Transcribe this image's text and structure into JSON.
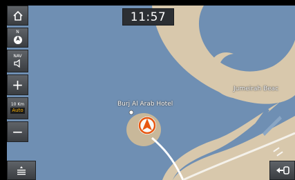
{
  "status": {
    "time": "11:57"
  },
  "controls": {
    "home_icon": "home-icon",
    "compass_label": "N",
    "nav_label": "NAV",
    "zoom_in": "+",
    "zoom_out": "−",
    "scale_label": "10 Km",
    "auto_label": "Auto",
    "menu_icon": "menu-icon",
    "back_icon": "return-icon"
  },
  "map": {
    "labels": {
      "poi": "Burj Al Arab Hotel",
      "area": "Jumeirah Beac"
    },
    "colors": {
      "water": "#6f8fb3",
      "land": "#d8c8ac",
      "island": "#c8b89a",
      "road": "#f4f1ea",
      "accent": "#e8560f"
    }
  }
}
